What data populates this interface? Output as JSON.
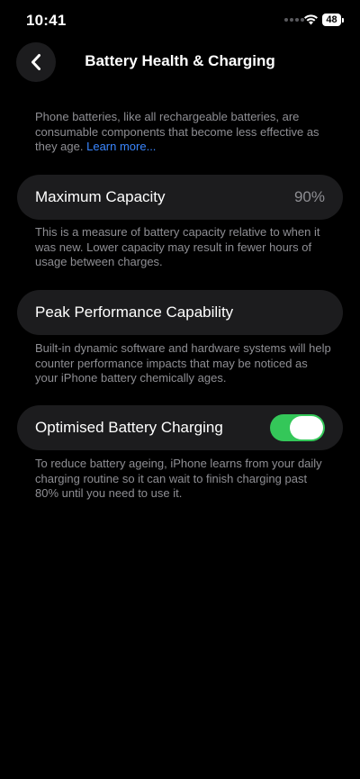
{
  "status_bar": {
    "time": "10:41",
    "battery_level": "48"
  },
  "nav": {
    "title": "Battery Health & Charging",
    "back_icon": "chevron-left-icon"
  },
  "intro": {
    "text": "Phone batteries, like all rechargeable batteries, are consumable components that become less effective as they age. ",
    "link": "Learn more..."
  },
  "maximum_capacity": {
    "label": "Maximum Capacity",
    "value": "90%",
    "description": "This is a measure of battery capacity relative to when it was new. Lower capacity may result in fewer hours of usage between charges."
  },
  "peak_performance": {
    "label": "Peak Performance Capability",
    "description": "Built-in dynamic software and hardware systems will help counter performance impacts that may be noticed as your iPhone battery chemically ages."
  },
  "optimised_charging": {
    "label": "Optimised Battery Charging",
    "enabled": true,
    "description": "To reduce battery ageing, iPhone learns from your daily charging routine so it can wait to finish charging past 80% until you need to use it."
  },
  "colors": {
    "background": "#000000",
    "cell_background": "#1c1c1e",
    "secondary_text": "#8e8e93",
    "link": "#3a86ff",
    "toggle_on": "#34c759"
  }
}
